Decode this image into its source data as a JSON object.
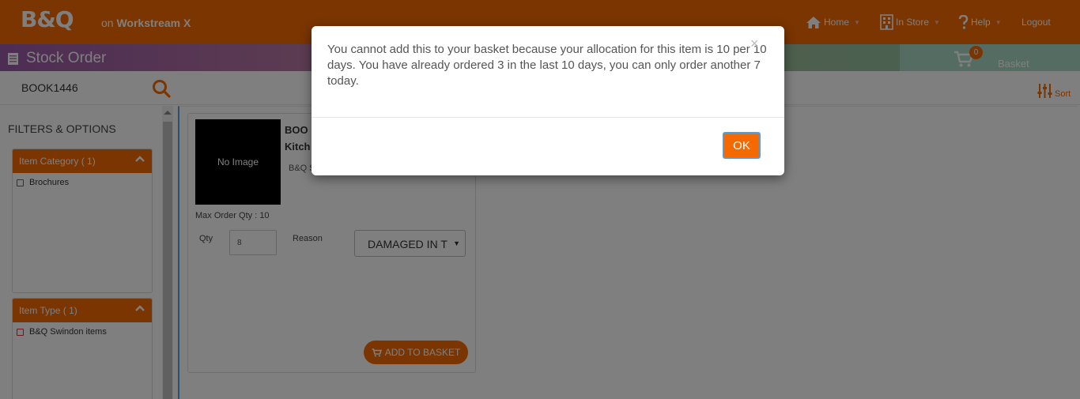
{
  "header": {
    "logo": "B&Q",
    "workstream_prefix": "on",
    "workstream_name": "Workstream X",
    "nav": {
      "home": "Home",
      "in_store": "In Store",
      "help": "Help",
      "logout": "Logout"
    }
  },
  "titlebar": {
    "title": "Stock Order",
    "basket_label": "Basket",
    "basket_count": "0"
  },
  "search": {
    "value": "BOOK1446"
  },
  "sort": {
    "label": "Sort"
  },
  "sidebar": {
    "title": "FILTERS & OPTIONS",
    "panels": [
      {
        "heading": "Item Category ( 1)",
        "options": [
          "Brochures"
        ]
      },
      {
        "heading": "Item Type ( 1)",
        "options": [
          "B&Q Swindon items"
        ]
      }
    ]
  },
  "product": {
    "image_placeholder": "No Image",
    "name_line1": "BOO",
    "name_line2": "Kitch",
    "subtitle": "B&Q S",
    "max_order_label": "Max Order Qty :",
    "max_order_value": "10",
    "qty_label": "Qty",
    "qty_value": "8",
    "reason_label": "Reason",
    "reason_value": "DAMAGED IN T",
    "add_button": "ADD TO BASKET"
  },
  "modal": {
    "message": "You cannot add this to your basket because your allocation for this item is 10 per 10 days. You have already ordered 3 in the last 10 days, you can only order another 7 today.",
    "close_symbol": "×",
    "ok_label": "OK"
  },
  "colors": {
    "brand_orange": "#f46a00",
    "focus_blue": "#5b9bd5"
  }
}
